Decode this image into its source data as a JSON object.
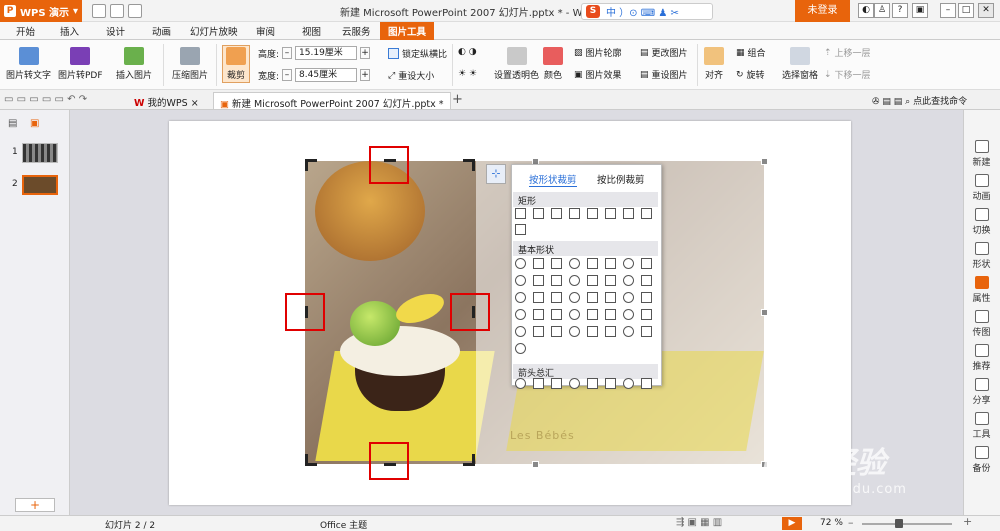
{
  "app": {
    "name": "WPS 演示",
    "window_title": "新建 Microsoft PowerPoint 2007 幻灯片.pptx * - WPS 演",
    "login": "未登录"
  },
  "ime": {
    "logo": "S",
    "items": "中 ）⊙ ⌨ ♟ ✂"
  },
  "menu_tabs": [
    "开始",
    "插入",
    "设计",
    "动画",
    "幻灯片放映",
    "审阅",
    "视图",
    "云服务"
  ],
  "active_tab": "图片工具",
  "ribbon": {
    "pic_to_text": "图片转文字",
    "pic_to_pdf": "图片转PDF",
    "insert_pic": "插入图片",
    "compress": "压缩图片",
    "crop": "裁剪",
    "height_label": "高度:",
    "height_value": "15.19厘米",
    "width_label": "宽度:",
    "width_value": "8.45厘米",
    "lock_ratio": "锁定纵横比",
    "reset_size": "重设大小",
    "transparent": "设置透明色",
    "color": "颜色",
    "outline": "图片轮廓",
    "effect": "图片效果",
    "change_pic": "更改图片",
    "reset_pic": "重设图片",
    "align": "对齐",
    "group": "组合",
    "rotate": "旋转",
    "select_pane": "选择窗格",
    "bring_forward": "上移一层",
    "send_backward": "下移一层"
  },
  "doc_tabs": {
    "home": "我的WPS",
    "doc": "新建 Microsoft PowerPoint 2007 幻灯片.pptx *",
    "search": "点此查找命令"
  },
  "slides": {
    "nums": [
      "1",
      "2"
    ],
    "add": "+"
  },
  "crop_menu": {
    "tab_shape": "按形状裁剪",
    "tab_ratio": "按比例裁剪",
    "sec_rect": "矩形",
    "sec_basic": "基本形状",
    "sec_arrow": "箭头总汇"
  },
  "photo": {
    "box_text": "Les Bébés"
  },
  "right_panel": [
    "新建",
    "动画",
    "切换",
    "形状",
    "属性",
    "传图",
    "推荐",
    "分享",
    "工具",
    "备份"
  ],
  "status": {
    "slide": "幻灯片 2 / 2",
    "theme": "Office 主题",
    "zoom": "72 %"
  },
  "watermark": {
    "brand": "Bai 经验",
    "url": "jingyan.baidu.com"
  }
}
